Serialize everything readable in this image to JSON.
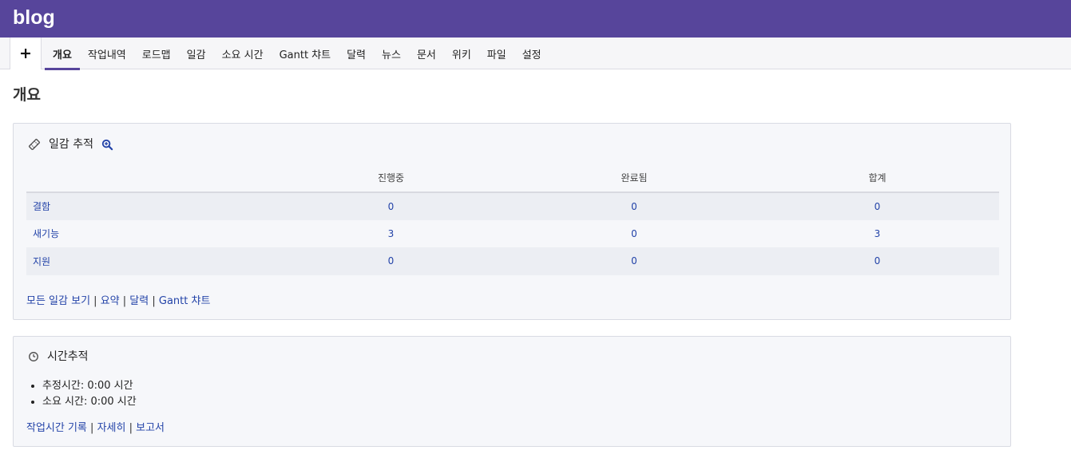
{
  "header": {
    "title": "blog"
  },
  "nav": {
    "new_button_icon": "plus-icon",
    "tabs": [
      {
        "label": "개요",
        "active": true
      },
      {
        "label": "작업내역"
      },
      {
        "label": "로드맵"
      },
      {
        "label": "일감"
      },
      {
        "label": "소요 시간"
      },
      {
        "label": "Gantt 챠트"
      },
      {
        "label": "달력"
      },
      {
        "label": "뉴스"
      },
      {
        "label": "문서"
      },
      {
        "label": "위키"
      },
      {
        "label": "파일"
      },
      {
        "label": "설정"
      }
    ]
  },
  "main": {
    "title": "개요",
    "issue_tracking": {
      "title": "일감 추적",
      "icon": "ticket-icon",
      "zoom_icon": "zoom-in-icon",
      "columns": [
        "",
        "진행중",
        "완료됨",
        "합계"
      ],
      "rows": [
        {
          "tracker": "결함",
          "open": "0",
          "closed": "0",
          "total": "0"
        },
        {
          "tracker": "새기능",
          "open": "3",
          "closed": "0",
          "total": "3"
        },
        {
          "tracker": "지원",
          "open": "0",
          "closed": "0",
          "total": "0"
        }
      ],
      "links": [
        "모든 일감 보기",
        "요약",
        "달력",
        "Gantt 챠트"
      ],
      "separator": "|"
    },
    "time_tracking": {
      "title": "시간추적",
      "icon": "clock-icon",
      "items": [
        "추정시간: 0:00 시간",
        "소요 시간: 0:00 시간"
      ],
      "links": [
        "작업시간 기록",
        "자세히",
        "보고서"
      ],
      "separator": "|"
    }
  },
  "colors": {
    "brand": "#57459b",
    "link": "#2343a8"
  }
}
